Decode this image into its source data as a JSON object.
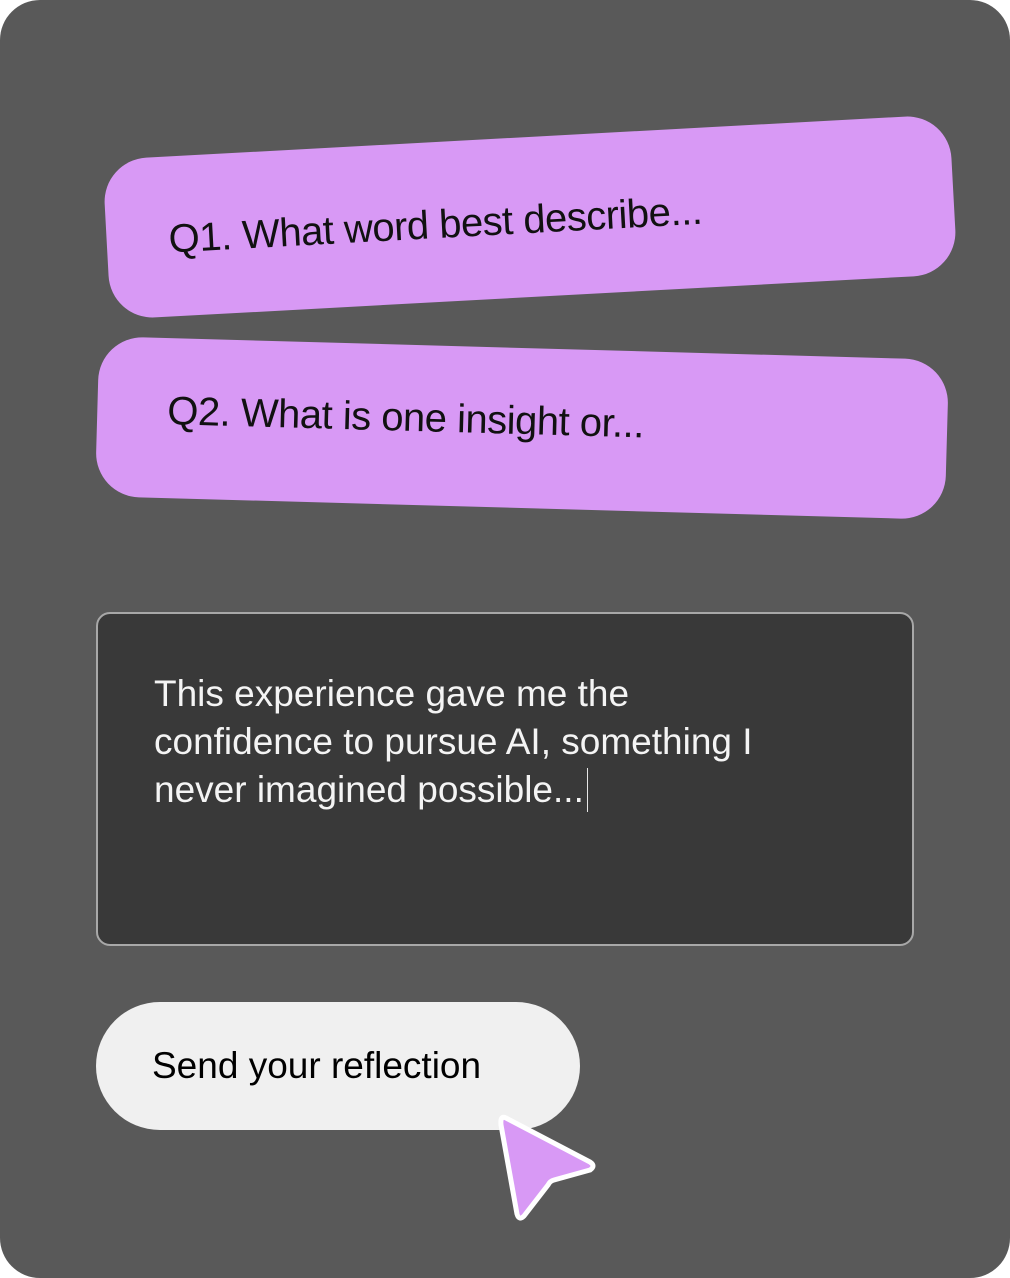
{
  "questions": [
    {
      "label": "Q1. What word best describe..."
    },
    {
      "label": "Q2. What is one insight or..."
    }
  ],
  "answer": {
    "line1": "This experience gave me the",
    "line2": "confidence to pursue AI, something I",
    "line3": "never imagined possible..."
  },
  "send_button": {
    "label": "Send your reflection"
  },
  "colors": {
    "background": "#595959",
    "accent": "#d899f5",
    "textarea_bg": "#393939",
    "button_bg": "#f0f0f0"
  },
  "icons": {
    "pointer": "mouse-pointer-icon"
  }
}
